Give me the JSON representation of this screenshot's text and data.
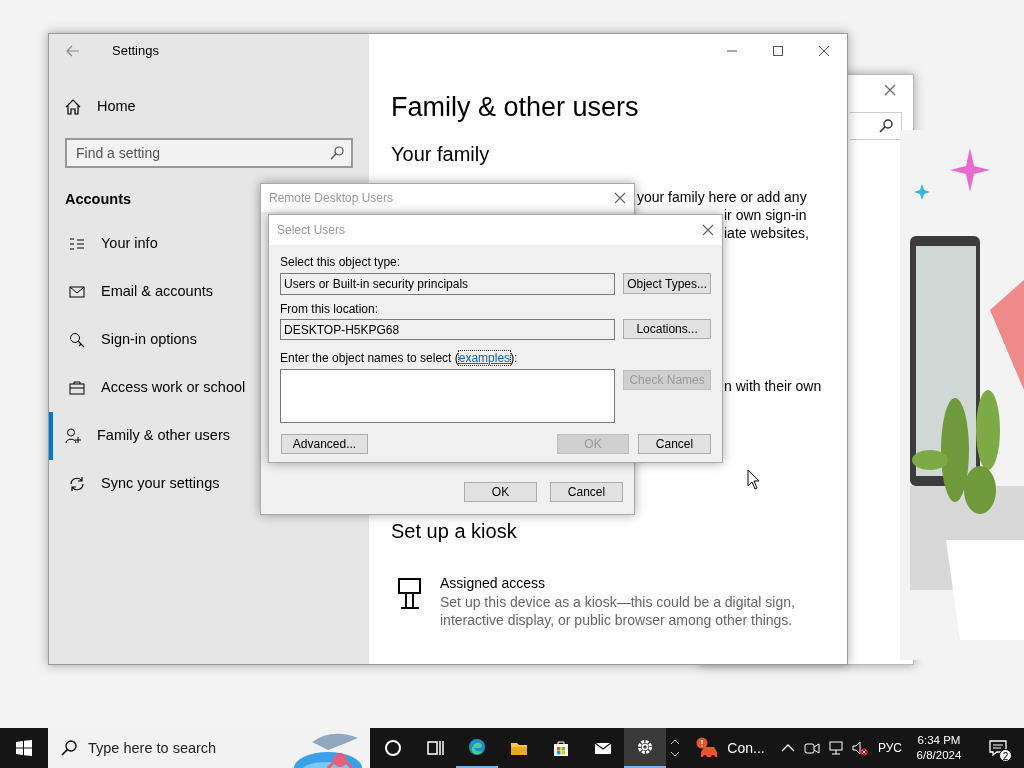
{
  "settings_window": {
    "title": "Settings",
    "home": "Home",
    "search": {
      "placeholder": "Find a setting"
    },
    "section": "Accounts",
    "nav": [
      {
        "label": "Your info",
        "selected": false
      },
      {
        "label": "Email & accounts",
        "selected": false
      },
      {
        "label": "Sign-in options",
        "selected": false
      },
      {
        "label": "Access work or school",
        "selected": false
      },
      {
        "label": "Family & other users",
        "selected": true
      },
      {
        "label": "Sync your settings",
        "selected": false
      }
    ],
    "page_title": "Family & other users",
    "family_heading": "Your family",
    "family_fragments": [
      {
        "text": "your family here or add any",
        "kind": "first"
      },
      {
        "text": "ir own sign-in",
        "kind": "right"
      },
      {
        "text": "iate websites,",
        "kind": "right"
      },
      {
        "text": "n with their own",
        "kind": "far"
      }
    ],
    "kiosk_heading": "Set up a kiosk",
    "kiosk_title": "Assigned access",
    "kiosk_text": "Set up this device as a kiosk—this could be a digital sign, interactive display, or public browser among other things."
  },
  "remote_desktop_dialog": {
    "title": "Remote Desktop Users",
    "ok_button": {
      "label": "OK"
    },
    "cancel_button": {
      "label": "Cancel"
    }
  },
  "select_users_dialog": {
    "title": "Select Users",
    "type_label": "Select this object type:",
    "type_value": "Users or Built-in security principals",
    "location_label": "From this location:",
    "location_value": "DESKTOP-H5KPG68",
    "names_label_before": "Enter the object names to select (",
    "names_link": "examples",
    "names_label_after": "):",
    "object_types_button": {
      "label": "Object Types...",
      "disabled": false
    },
    "locations_button": {
      "label": "Locations...",
      "disabled": false
    },
    "check_names_button": {
      "label": "Check Names",
      "disabled": true
    },
    "advanced_button": {
      "label": "Advanced...",
      "disabled": false
    },
    "ok_button": {
      "label": "OK",
      "disabled": true
    },
    "cancel_button": {
      "label": "Cancel",
      "disabled": false
    }
  },
  "taskbar": {
    "search": {
      "placeholder": "Type here to search"
    },
    "apps": [
      {
        "kind": "cortana",
        "running": false,
        "selected": false
      },
      {
        "kind": "task-view",
        "running": false,
        "selected": false
      },
      {
        "kind": "edge",
        "running": true,
        "selected": false
      },
      {
        "kind": "explorer",
        "running": false,
        "selected": false
      },
      {
        "kind": "store",
        "running": false,
        "selected": false
      },
      {
        "kind": "mail",
        "running": false,
        "selected": false
      },
      {
        "kind": "settings",
        "running": true,
        "selected": true
      }
    ],
    "notification": "Con...",
    "volume_muted": true,
    "language": "РУС",
    "time": "6:34 PM",
    "date": "6/8/2024",
    "action_center_badge": "2"
  }
}
